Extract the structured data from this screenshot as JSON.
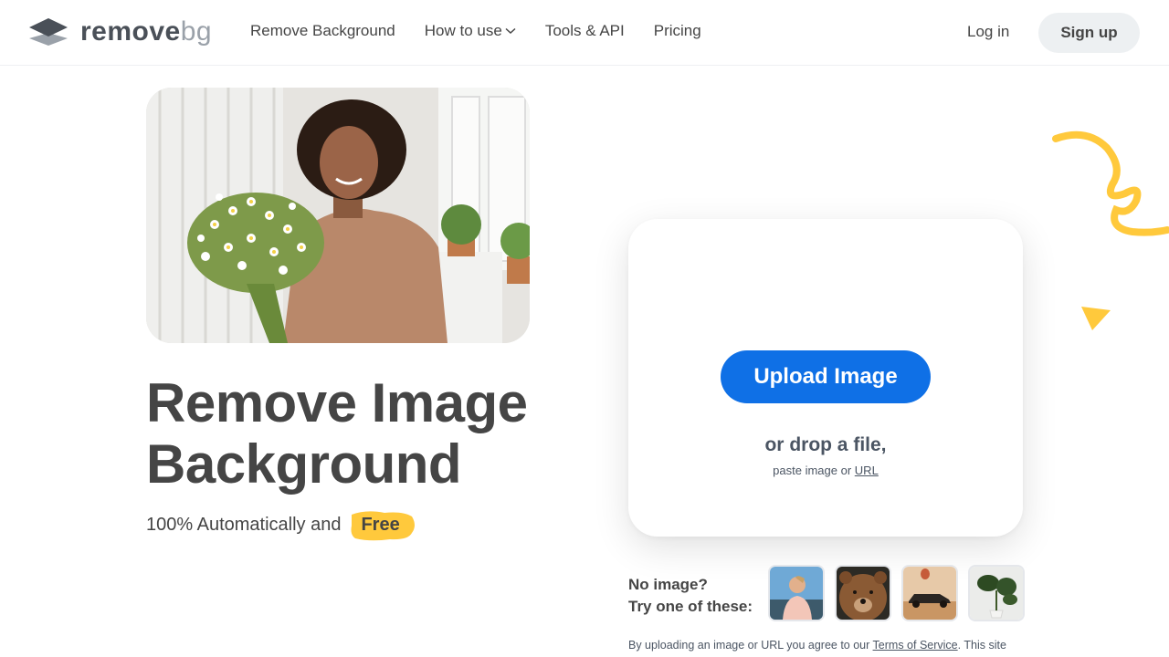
{
  "header": {
    "logo_text": "remove",
    "logo_text_bg": "bg",
    "nav": [
      {
        "label": "Remove Background"
      },
      {
        "label": "How to use"
      },
      {
        "label": "Tools & API"
      },
      {
        "label": "Pricing"
      }
    ],
    "login_label": "Log in",
    "signup_label": "Sign up"
  },
  "hero": {
    "title_line1": "Remove Image",
    "title_line2": "Background",
    "subtitle": "100% Automatically and",
    "free_badge": "Free"
  },
  "upload": {
    "button_label": "Upload Image",
    "drop_text": "or drop a file,",
    "paste_prefix": "paste image or",
    "url_link": "URL"
  },
  "samples": {
    "line1": "No image?",
    "line2": "Try one of these:"
  },
  "legal": {
    "prefix": "By uploading an image or URL you agree to our",
    "tos_link": "Terms of Service",
    "suffix": ". This site"
  },
  "colors": {
    "primary": "#0f70e6",
    "accent_yellow": "#ffc93c",
    "text": "#454545"
  }
}
